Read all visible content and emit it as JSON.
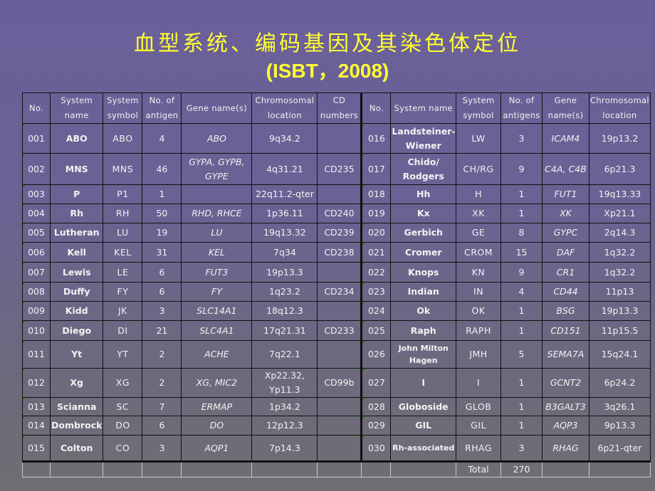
{
  "title": "血型系统、编码基因及其染色体定位",
  "subtitle": "(ISBT，2008)",
  "left_headers": [
    "No.",
    "System name",
    "System symbol",
    "No. of antigen",
    "Gene name(s)",
    "Chromosomal location",
    "CD numbers"
  ],
  "right_headers": [
    "No.",
    "System name",
    "System symbol",
    "No. of antigens",
    "Gene name(s)",
    "Chromosomal location"
  ],
  "rows": [
    {
      "left": {
        "no": "001",
        "name": "ABO",
        "symbol": "ABO",
        "antigens": "4",
        "gene": "ABO",
        "location": "9q34.2",
        "cd": ""
      },
      "right": {
        "no": "016",
        "name": "Landsteiner-Wiener",
        "symbol": "LW",
        "antigens": "3",
        "gene": "ICAM4",
        "location": "19p13.2"
      }
    },
    {
      "left": {
        "no": "002",
        "name": "MNS",
        "symbol": "MNS",
        "antigens": "46",
        "gene": "GYPA, GYPB, GYPE",
        "location": "4q31.21",
        "cd": "CD235"
      },
      "right": {
        "no": "017",
        "name": "Chido/ Rodgers",
        "symbol": "CH/RG",
        "antigens": "9",
        "gene": "C4A, C4B",
        "location": "6p21.3"
      }
    },
    {
      "left": {
        "no": "003",
        "name": "P",
        "symbol": "P1",
        "antigens": "1",
        "gene": "",
        "location": "22q11.2-qter",
        "cd": ""
      },
      "right": {
        "no": "018",
        "name": "Hh",
        "symbol": "H",
        "antigens": "1",
        "gene": "FUT1",
        "location": "19q13.33"
      }
    },
    {
      "left": {
        "no": "004",
        "name": "Rh",
        "symbol": "RH",
        "antigens": "50",
        "gene": "RHD, RHCE",
        "location": "1p36.11",
        "cd": "CD240"
      },
      "right": {
        "no": "019",
        "name": "Kx",
        "symbol": "XK",
        "antigens": "1",
        "gene": "XK",
        "location": "Xp21.1"
      }
    },
    {
      "left": {
        "no": "005",
        "name": "Lutheran",
        "symbol": "LU",
        "antigens": "19",
        "gene": "LU",
        "location": "19q13.32",
        "cd": "CD239"
      },
      "right": {
        "no": "020",
        "name": "Gerbich",
        "symbol": "GE",
        "antigens": "8",
        "gene": "GYPC",
        "location": "2q14.3"
      }
    },
    {
      "left": {
        "no": "006",
        "name": "Kell",
        "symbol": "KEL",
        "antigens": "31",
        "gene": "KEL",
        "location": "7q34",
        "cd": "CD238"
      },
      "right": {
        "no": "021",
        "name": "Cromer",
        "symbol": "CROM",
        "antigens": "15",
        "gene": "DAF",
        "location": "1q32.2"
      }
    },
    {
      "left": {
        "no": "007",
        "name": "Lewis",
        "symbol": "LE",
        "antigens": "6",
        "gene": "FUT3",
        "location": "19p13.3",
        "cd": ""
      },
      "right": {
        "no": "022",
        "name": "Knops",
        "symbol": "KN",
        "antigens": "9",
        "gene": "CR1",
        "location": "1q32.2"
      }
    },
    {
      "left": {
        "no": "008",
        "name": "Duffy",
        "symbol": "FY",
        "antigens": "6",
        "gene": "FY",
        "location": "1q23.2",
        "cd": "CD234"
      },
      "right": {
        "no": "023",
        "name": "Indian",
        "symbol": "IN",
        "antigens": "4",
        "gene": "CD44",
        "location": "11p13"
      }
    },
    {
      "left": {
        "no": "009",
        "name": "Kidd",
        "symbol": "JK",
        "antigens": "3",
        "gene": "SLC14A1",
        "location": "18q12.3",
        "cd": ""
      },
      "right": {
        "no": "024",
        "name": "Ok",
        "symbol": "OK",
        "antigens": "1",
        "gene": "BSG",
        "location": "19p13.3"
      }
    },
    {
      "left": {
        "no": "010",
        "name": "Diego",
        "symbol": "DI",
        "antigens": "21",
        "gene": "SLC4A1",
        "location": "17q21.31",
        "cd": "CD233"
      },
      "right": {
        "no": "025",
        "name": "Raph",
        "symbol": "RAPH",
        "antigens": "1",
        "gene": "CD151",
        "location": "11p15.5"
      }
    },
    {
      "left": {
        "no": "011",
        "name": "Yt",
        "symbol": "YT",
        "antigens": "2",
        "gene": "ACHE",
        "location": "7q22.1",
        "cd": ""
      },
      "right": {
        "no": "026",
        "name": "John Milton Hagen",
        "symbol": "JMH",
        "antigens": "5",
        "gene": "SEMA7A",
        "location": "15q24.1"
      }
    },
    {
      "left": {
        "no": "012",
        "name": "Xg",
        "symbol": "XG",
        "antigens": "2",
        "gene": "XG, MIC2",
        "location": "Xp22.32, Yp11.3",
        "cd": "CD99b"
      },
      "right": {
        "no": "027",
        "name": "I",
        "symbol": "I",
        "antigens": "1",
        "gene": "GCNT2",
        "location": "6p24.2"
      }
    },
    {
      "left": {
        "no": "013",
        "name": "Scianna",
        "symbol": "SC",
        "antigens": "7",
        "gene": "ERMAP",
        "location": "1p34.2",
        "cd": ""
      },
      "right": {
        "no": "028",
        "name": "Globoside",
        "symbol": "GLOB",
        "antigens": "1",
        "gene": "B3GALT3",
        "location": "3q26.1"
      }
    },
    {
      "left": {
        "no": "014",
        "name": "Dombrock",
        "symbol": "DO",
        "antigens": "6",
        "gene": "DO",
        "location": "12p12.3",
        "cd": ""
      },
      "right": {
        "no": "029",
        "name": "GIL",
        "symbol": "GIL",
        "antigens": "1",
        "gene": "AQP3",
        "location": "9p13.3"
      }
    },
    {
      "left": {
        "no": "015",
        "name": "Colton",
        "symbol": "CO",
        "antigens": "3",
        "gene": "AQP1",
        "location": "7p14.3",
        "cd": ""
      },
      "right": {
        "no": "030",
        "name": "Rh-associated",
        "symbol": "RHAG",
        "antigens": "3",
        "gene": "RHAG",
        "location": "6p21-qter"
      }
    }
  ],
  "total": {
    "label": "Total",
    "value": "270"
  }
}
